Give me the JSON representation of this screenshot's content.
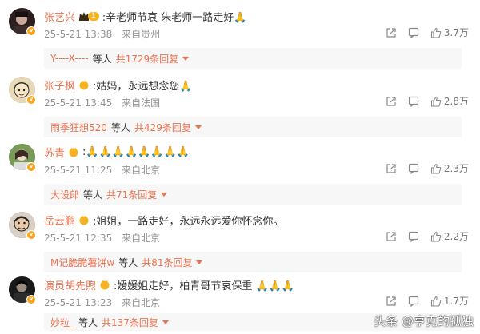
{
  "comments": [
    {
      "username": "张艺兴",
      "level": "1",
      "text": ":辛老师节哀 朱老师一路走好🙏",
      "date": "25-5-21 13:38",
      "location": "来自贵州",
      "likes": "3.7万",
      "reply_user": "Y----X----",
      "reply_mid": "等人",
      "reply_count": "共1729条回复"
    },
    {
      "username": "张子枫",
      "text": ":姑妈，永远想念您🙏",
      "date": "25-5-21 13:45",
      "location": "来自法国",
      "likes": "2.8万",
      "reply_user": "雨季狂想520",
      "reply_mid": "等人",
      "reply_count": "共429条回复"
    },
    {
      "username": "苏青",
      "text": ":🙏🙏🙏🙏🙏🙏🙏🙏",
      "date": "25-5-21 11:25",
      "location": "来自北京",
      "likes": "2.3万",
      "reply_user": "大设郎",
      "reply_mid": "等人",
      "reply_count": "共71条回复"
    },
    {
      "username": "岳云鹏",
      "text": ":姐姐，一路走好，永远永远爱你怀念你。",
      "date": "25-5-21 12:35",
      "location": "来自北京",
      "likes": "2.2万",
      "reply_user": "M记脆脆薯饼w",
      "reply_mid": "等人",
      "reply_count": "共81条回复"
    },
    {
      "username": "演员胡先煦",
      "text": ":媛媛姐走好，柏青哥节哀保重 🙏🙏🙏",
      "date": "25-5-21 13:23",
      "location": "来自北京",
      "likes": "1.7万",
      "reply_user": "妙粒_",
      "reply_mid": "等人",
      "reply_count": "共137条回复"
    }
  ],
  "watermark": "头条 @亨克的孤独",
  "colors": {
    "username": "#eb7350",
    "meta": "#939393",
    "reply_bg": "#f7f7f7",
    "badge_gold": "#f6b321"
  }
}
